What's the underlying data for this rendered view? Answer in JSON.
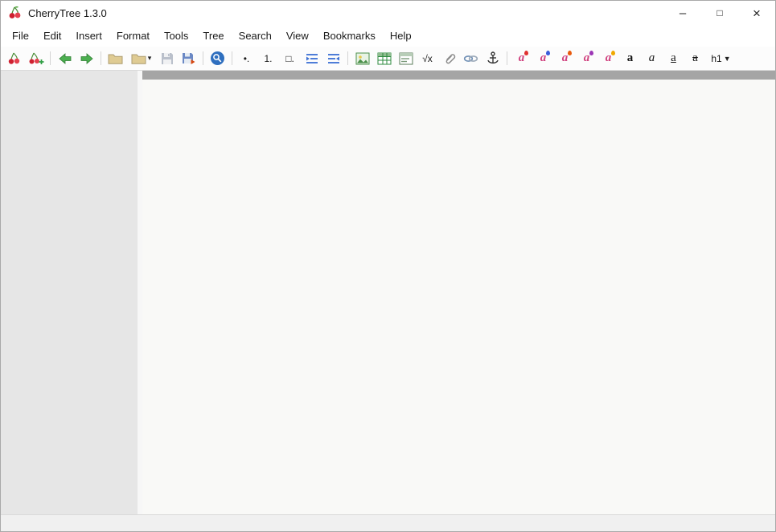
{
  "window": {
    "title": "CherryTree 1.3.0",
    "controls": {
      "minimize": "–",
      "maximize": "□",
      "close": "×"
    }
  },
  "menubar": {
    "items": [
      "File",
      "Edit",
      "Insert",
      "Format",
      "Tools",
      "Tree",
      "Search",
      "View",
      "Bookmarks",
      "Help"
    ]
  },
  "toolbar": {
    "glyphs": {
      "bullet_list": "•.",
      "numbered_list": "1.",
      "todo_list": "□.",
      "formula": "√x",
      "format_letter": "a",
      "heading": "h1",
      "dropdown": "▼",
      "dropdown_small": "▾"
    }
  },
  "statusbar": {
    "text": ""
  },
  "icons": {
    "app-icon": "red cherries with green stem",
    "cherry-icon": "red cherries (add node)",
    "cherry-plus-icon": "cherries with green plus (add subnode)",
    "back-arrow-icon": "green arrow left",
    "forward-arrow-icon": "green arrow right",
    "open-folder-icon": "folder",
    "chevron-down-icon": "small down triangle",
    "save-icon": "floppy disk (disabled)",
    "save-as-icon": "floppy disk with red arrow",
    "find-icon": "blue sphere with magnifier",
    "bullet-list-icon": "bullet dot with period",
    "numbered-list-icon": "digit 1 with period",
    "todo-list-icon": "empty checkbox with period",
    "indent-icon": "blue lines with right arrow",
    "unindent-icon": "blue lines with left arrow",
    "insert-image-icon": "framed landscape picture",
    "insert-table-icon": "green grid table",
    "insert-codebox-icon": "code box grid",
    "formula-icon": "square root of x",
    "paperclip-icon": "paperclip",
    "link-icon": "chain links",
    "anchor-icon": "anchor",
    "format-letter-icon": "pink letter a with color drop",
    "bold-a-icon": "bold letter a",
    "italic-a-icon": "italic letter a",
    "underline-a-icon": "underlined letter a",
    "strikethrough-a-icon": "struck-through letter a"
  },
  "colors": {
    "cherry_red": "#cf2030",
    "leaf_green": "#4d8f3a",
    "arrow_green": "#4caf50",
    "accent_blue": "#2f6fbf",
    "indent_blue": "#3b6fd4",
    "format_pink": "#d0427f",
    "tree_panel_bg": "#e6e6e6",
    "editor_bg": "#f9f9f7",
    "editor_header_strip": "#a5a5a5",
    "toolbar_bg": "#fcfcfc",
    "statusbar_bg": "#f0f0f0"
  }
}
